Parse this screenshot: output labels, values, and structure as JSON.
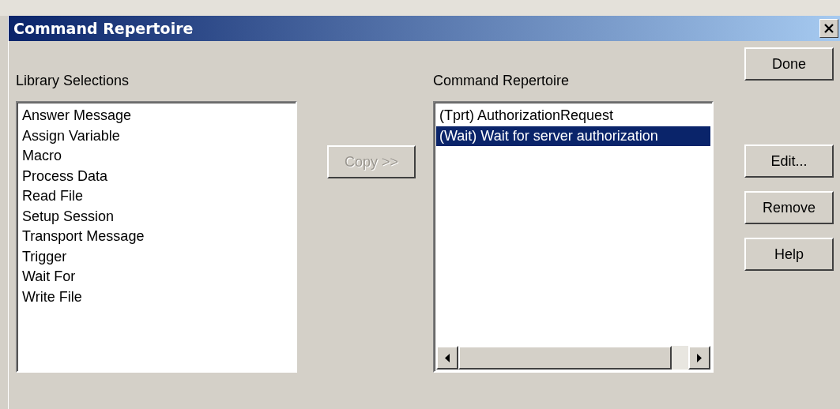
{
  "window": {
    "title": "Command Repertoire"
  },
  "library": {
    "label": "Library Selections",
    "items": [
      {
        "label": "Answer Message",
        "selected": false
      },
      {
        "label": "Assign Variable",
        "selected": false
      },
      {
        "label": "Macro",
        "selected": false
      },
      {
        "label": "Process Data",
        "selected": false
      },
      {
        "label": "Read File",
        "selected": false
      },
      {
        "label": "Setup Session",
        "selected": false
      },
      {
        "label": "Transport Message",
        "selected": false
      },
      {
        "label": "Trigger",
        "selected": false
      },
      {
        "label": "Wait For",
        "selected": false
      },
      {
        "label": "Write File",
        "selected": false
      }
    ]
  },
  "copy_button": {
    "label": "Copy >>",
    "disabled": true
  },
  "repertoire": {
    "label": "Command Repertoire",
    "items": [
      {
        "label": "(Tprt) AuthorizationRequest",
        "selected": false
      },
      {
        "label": "(Wait) Wait for server authorization",
        "selected": true
      }
    ]
  },
  "buttons": [
    {
      "label": "Done",
      "disabled": false
    },
    {
      "label": "Edit...",
      "disabled": false
    },
    {
      "label": "Remove",
      "disabled": false
    },
    {
      "label": "Help",
      "disabled": false
    }
  ]
}
